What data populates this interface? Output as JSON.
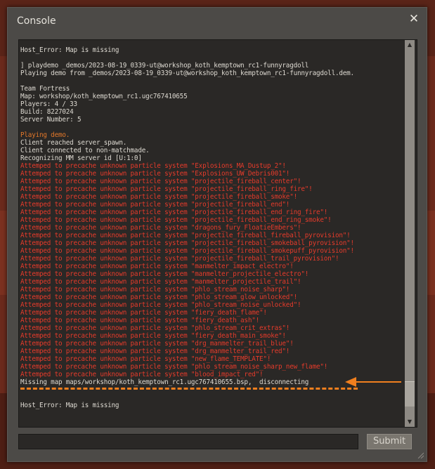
{
  "window": {
    "title": "Console",
    "close_glyph": "✕"
  },
  "log_lines": [
    {
      "text": "Host_Error: Map is missing",
      "color": "white"
    },
    {
      "text": "",
      "color": "white"
    },
    {
      "text": "] playdemo _demos/2023-08-19_0339-ut@workshop_koth_kemptown_rc1-funnyragdoll",
      "color": "white"
    },
    {
      "text": "Playing demo from _demos/2023-08-19_0339-ut@workshop_koth_kemptown_rc1-funnyragdoll.dem.",
      "color": "white"
    },
    {
      "text": "",
      "color": "white"
    },
    {
      "text": "Team Fortress",
      "color": "white"
    },
    {
      "text": "Map: workshop/koth_kemptown_rc1.ugc767410655",
      "color": "white"
    },
    {
      "text": "Players: 4 / 33",
      "color": "white"
    },
    {
      "text": "Build: 8227024",
      "color": "white"
    },
    {
      "text": "Server Number: 5",
      "color": "white"
    },
    {
      "text": "",
      "color": "white"
    },
    {
      "text": "Playing demo.",
      "color": "orange"
    },
    {
      "text": "Client reached server_spawn.",
      "color": "white"
    },
    {
      "text": "Client connected to non-matchmade.",
      "color": "white"
    },
    {
      "text": "Recognizing MM server id [U:1:0]",
      "color": "white"
    },
    {
      "text": "Attemped to precache unknown particle system \"Explosions_MA_Dustup_2\"!",
      "color": "red"
    },
    {
      "text": "Attemped to precache unknown particle system \"Explosions_UW_Debris001\"!",
      "color": "red"
    },
    {
      "text": "Attemped to precache unknown particle system \"projectile_fireball_center\"!",
      "color": "red"
    },
    {
      "text": "Attemped to precache unknown particle system \"projectile_fireball_ring_fire\"!",
      "color": "red"
    },
    {
      "text": "Attemped to precache unknown particle system \"projectile_fireball_smoke\"!",
      "color": "red"
    },
    {
      "text": "Attemped to precache unknown particle system \"projectile_fireball_end\"!",
      "color": "red"
    },
    {
      "text": "Attemped to precache unknown particle system \"projectile_fireball_end_ring_fire\"!",
      "color": "red"
    },
    {
      "text": "Attemped to precache unknown particle system \"projectile_fireball_end_ring_smoke\"!",
      "color": "red"
    },
    {
      "text": "Attemped to precache unknown particle system \"dragons_fury_FloatieEmbers\"!",
      "color": "red"
    },
    {
      "text": "Attemped to precache unknown particle system \"projectile_fireball_fireball_pyrovision\"!",
      "color": "red"
    },
    {
      "text": "Attemped to precache unknown particle system \"projectile_fireball_smokeball_pyrovision\"!",
      "color": "red"
    },
    {
      "text": "Attemped to precache unknown particle system \"projectile_fireball_smokepuff_pyrovision\"!",
      "color": "red"
    },
    {
      "text": "Attemped to precache unknown particle system \"projectile_fireball_trail_pyrovision\"!",
      "color": "red"
    },
    {
      "text": "Attemped to precache unknown particle system \"manmelter_impact_electro\"!",
      "color": "red"
    },
    {
      "text": "Attemped to precache unknown particle system \"manmelter_projectile_electro\"!",
      "color": "red"
    },
    {
      "text": "Attemped to precache unknown particle system \"manmelter_projectile_trail\"!",
      "color": "red"
    },
    {
      "text": "Attemped to precache unknown particle system \"phlo_stream_noise_sharp\"!",
      "color": "red"
    },
    {
      "text": "Attemped to precache unknown particle system \"phlo_stream_glow_unlocked\"!",
      "color": "red"
    },
    {
      "text": "Attemped to precache unknown particle system \"phlo_stream_noise_unlocked\"!",
      "color": "red"
    },
    {
      "text": "Attemped to precache unknown particle system \"fiery_death_flame\"!",
      "color": "red"
    },
    {
      "text": "Attemped to precache unknown particle system \"fiery_death_ash\"!",
      "color": "red"
    },
    {
      "text": "Attemped to precache unknown particle system \"phlo_stream_crit_extras\"!",
      "color": "red"
    },
    {
      "text": "Attemped to precache unknown particle system \"fiery_death_main_smoke\"!",
      "color": "red"
    },
    {
      "text": "Attemped to precache unknown particle system \"drg_manmelter_trail_blue\"!",
      "color": "red"
    },
    {
      "text": "Attemped to precache unknown particle system \"drg_manmelter_trail_red\"!",
      "color": "red"
    },
    {
      "text": "Attemped to precache unknown particle system \"new_flame_TEMPLATE\"!",
      "color": "red"
    },
    {
      "text": "Attemped to precache unknown particle system \"phlo_stream_noise_sharp_new_flame\"!",
      "color": "red"
    },
    {
      "text": "Attemped to precache unknown particle system \"blood_impact_red\"!",
      "color": "red"
    },
    {
      "text": "Missing map maps/workshop/koth_kemptown_rc1.ugc767410655.bsp,  disconnecting",
      "color": "white"
    },
    {
      "text": "",
      "color": "white"
    },
    {
      "text": "",
      "color": "white"
    },
    {
      "text": "Host_Error: Map is missing",
      "color": "white"
    }
  ],
  "command_input": {
    "value": "",
    "placeholder": ""
  },
  "submit_label": "Submit",
  "colors": {
    "annotation": "#f07f1e",
    "error_red": "#e63b2b",
    "info_orange": "#e3782a"
  }
}
